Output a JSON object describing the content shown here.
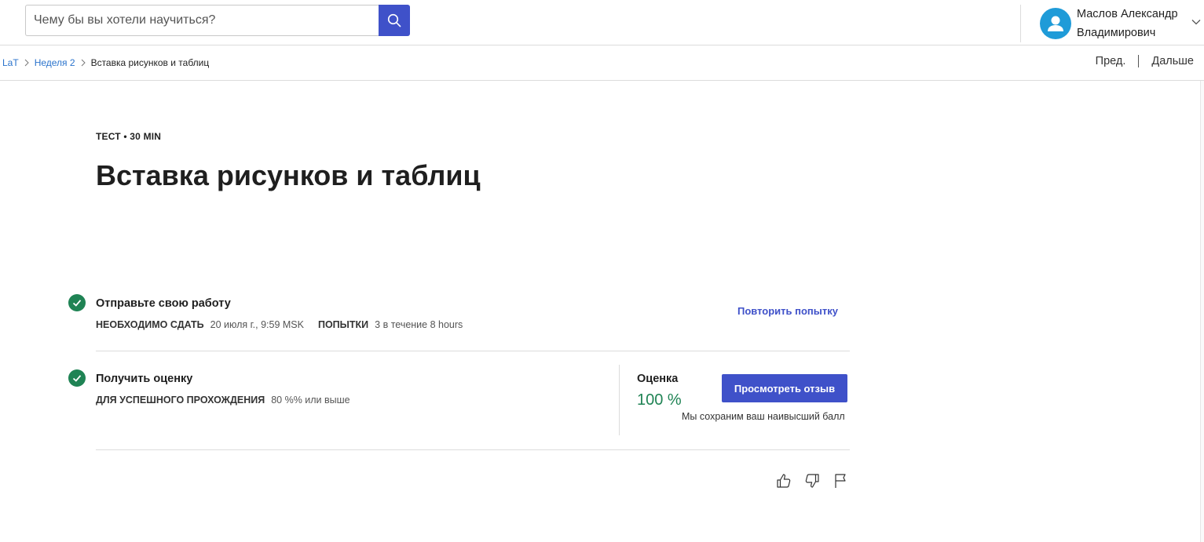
{
  "header": {
    "search": {
      "placeholder": "Чему бы вы хотели научиться?",
      "value": ""
    },
    "user": {
      "name": "Маслов Александр Владимирович"
    }
  },
  "breadcrumb": {
    "items": [
      "LaT",
      "Неделя 2"
    ],
    "current": "Вставка рисунков и таблиц"
  },
  "nav": {
    "prev": "Пред.",
    "next": "Дальше"
  },
  "page": {
    "meta": "ТЕСТ • 30 MIN",
    "title": "Вставка рисунков и таблиц"
  },
  "submit": {
    "title": "Отправьте свою работу",
    "due_label": "НЕОБХОДИМО СДАТЬ",
    "due_value": "20 июля г., 9:59 MSK",
    "attempts_label": "ПОПЫТКИ",
    "attempts_value": "3 в течение 8 hours",
    "retry_label": "Повторить попытку"
  },
  "grade": {
    "title": "Получить оценку",
    "pass_label": "ДЛЯ УСПЕШНОГО ПРОХОЖДЕНИЯ",
    "pass_value": "80 %% или выше",
    "score_label": "Оценка",
    "score_value": "100 %",
    "feedback_button": "Просмотреть отзыв",
    "note": "Мы сохраним ваш наивысший балл"
  },
  "colors": {
    "accent": "#3f51c9",
    "success": "#1f8354",
    "avatar": "#1f9bd8"
  },
  "icons": [
    "search-icon",
    "user-icon",
    "chevron-down-icon",
    "check-icon",
    "thumbs-up-icon",
    "thumbs-down-icon",
    "flag-icon"
  ]
}
